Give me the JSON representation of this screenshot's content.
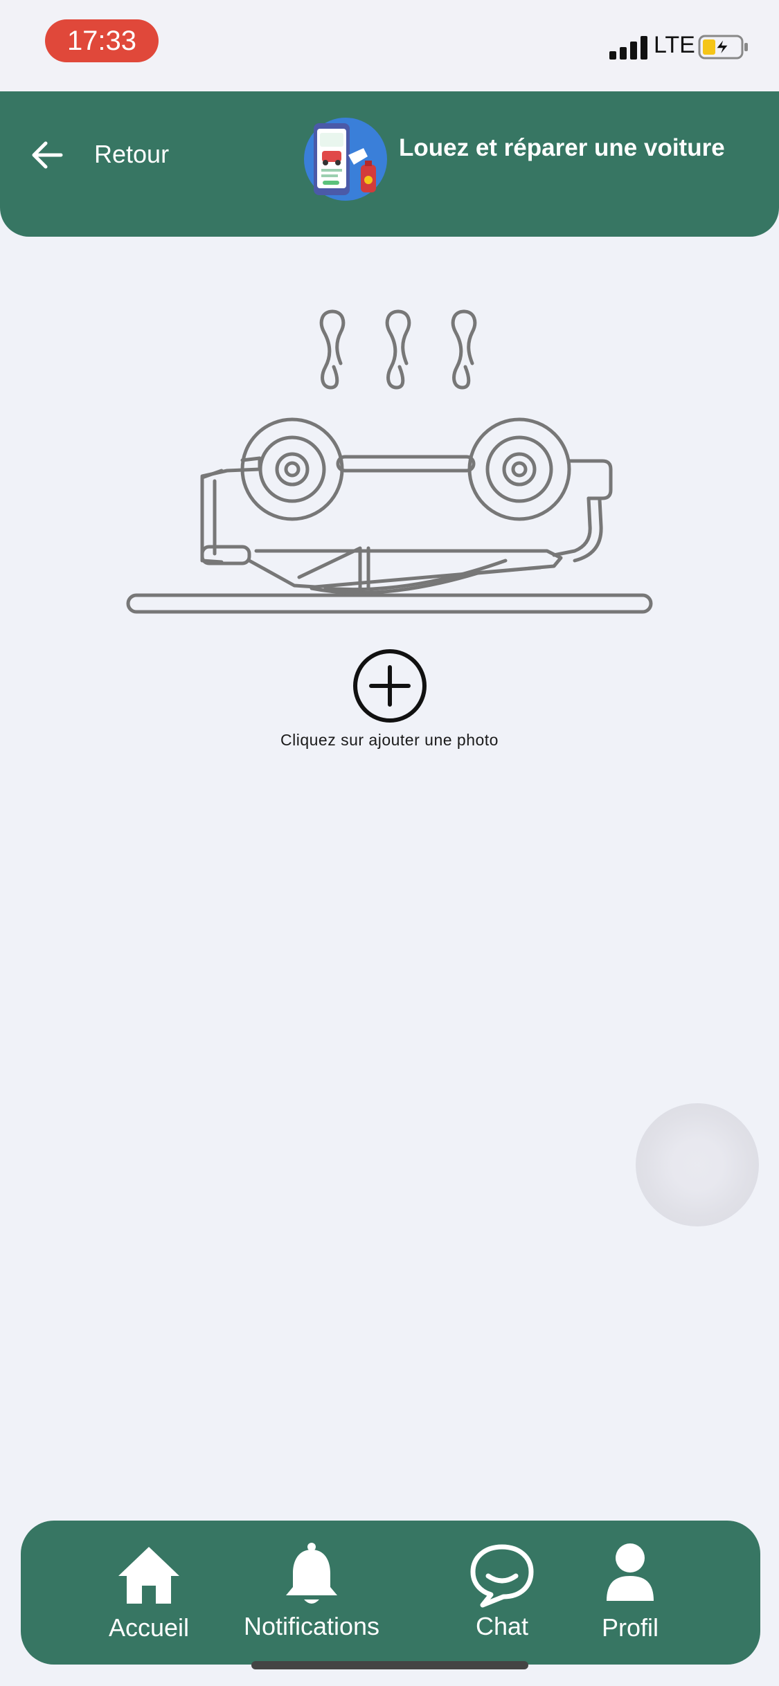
{
  "status_bar": {
    "time": "17:33",
    "network": "LTE",
    "time_pill_color": "#e0483a"
  },
  "header": {
    "back_label": "Retour",
    "title": "Louez et réparer une voiture",
    "background": "#377663"
  },
  "main": {
    "illustration_icon": "overturned-car-icon",
    "add_photo_icon": "plus-circle-icon",
    "hint": "Cliquez sur ajouter une photo"
  },
  "bottom_nav": {
    "items": [
      {
        "label": "Accueil",
        "icon": "home-icon"
      },
      {
        "label": "Notifications",
        "icon": "bell-icon"
      },
      {
        "label": "Chat",
        "icon": "chat-icon"
      },
      {
        "label": "Profil",
        "icon": "user-icon"
      }
    ]
  }
}
